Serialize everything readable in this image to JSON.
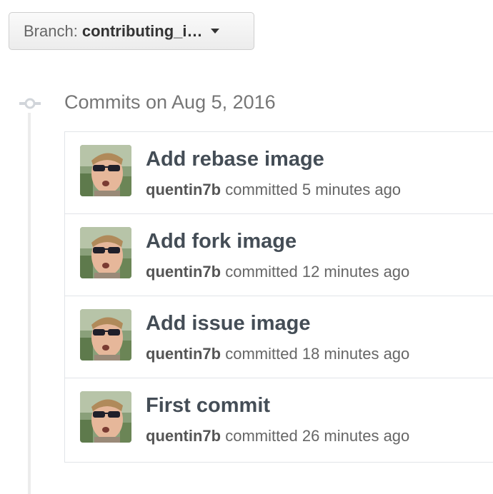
{
  "branch": {
    "prefix": "Branch:",
    "name": "contributing_i…"
  },
  "date_heading": "Commits on Aug 5, 2016",
  "commits": [
    {
      "title": "Add rebase image",
      "author": "quentin7b",
      "verb": "committed",
      "time": "5 minutes ago"
    },
    {
      "title": "Add fork image",
      "author": "quentin7b",
      "verb": "committed",
      "time": "12 minutes ago"
    },
    {
      "title": "Add issue image",
      "author": "quentin7b",
      "verb": "committed",
      "time": "18 minutes ago"
    },
    {
      "title": "First commit",
      "author": "quentin7b",
      "verb": "committed",
      "time": "26 minutes ago"
    }
  ],
  "icons": {
    "caret": "caret-down-icon",
    "timeline": "git-commit-icon",
    "avatar": "user-avatar"
  }
}
